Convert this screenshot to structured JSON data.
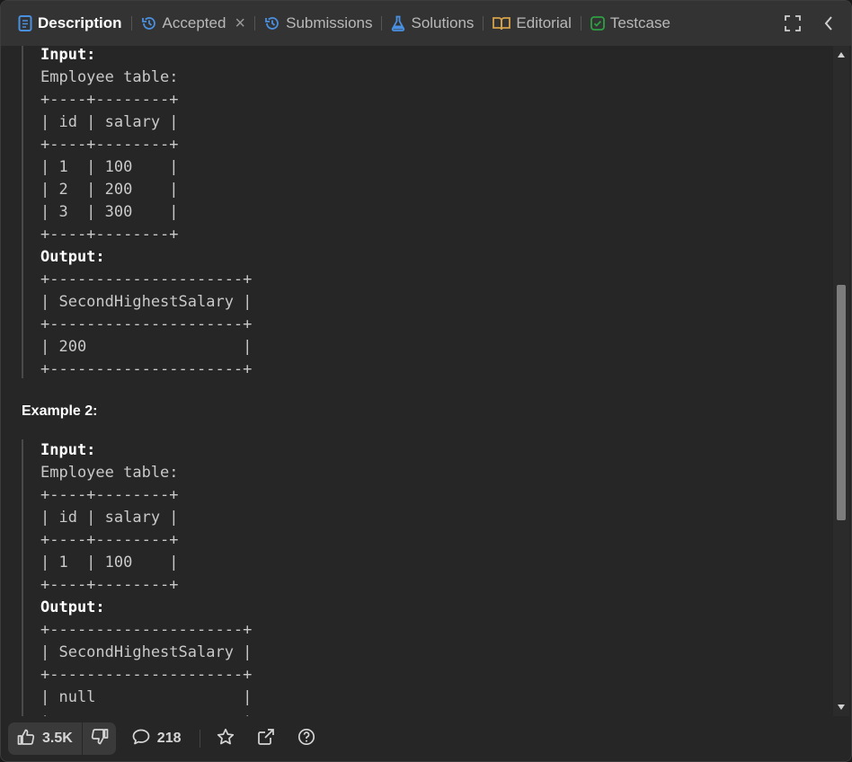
{
  "tabs": [
    {
      "label": "Description",
      "icon": "document-icon",
      "active": true
    },
    {
      "label": "Accepted",
      "icon": "history-icon",
      "closable": true
    },
    {
      "label": "Submissions",
      "icon": "history-icon"
    },
    {
      "label": "Solutions",
      "icon": "flask-icon"
    },
    {
      "label": "Editorial",
      "icon": "book-icon"
    },
    {
      "label": "Testcase",
      "icon": "checkbox-icon"
    }
  ],
  "example1": {
    "input_label": "Input:",
    "input_text": "Employee table:\n+----+--------+\n| id | salary |\n+----+--------+\n| 1  | 100    |\n| 2  | 200    |\n| 3  | 300    |\n+----+--------+",
    "output_label": "Output:",
    "output_text": "+---------------------+\n| SecondHighestSalary |\n+---------------------+\n| 200                 |\n+---------------------+"
  },
  "example2": {
    "title": "Example 2:",
    "input_label": "Input:",
    "input_text": "Employee table:\n+----+--------+\n| id | salary |\n+----+--------+\n| 1  | 100    |\n+----+--------+",
    "output_label": "Output:",
    "output_text": "+---------------------+\n| SecondHighestSalary |\n+---------------------+\n| null                |\n+---------------------+"
  },
  "footer": {
    "likes": "3.5K",
    "comments": "218"
  },
  "colors": {
    "background": "#262626",
    "tabbar": "#333333",
    "description_icon": "#4a90e2",
    "history_icon": "#4a90e2",
    "flask_icon": "#4a90e2",
    "book_icon": "#d4a24a",
    "checkbox_icon": "#2ea043"
  }
}
